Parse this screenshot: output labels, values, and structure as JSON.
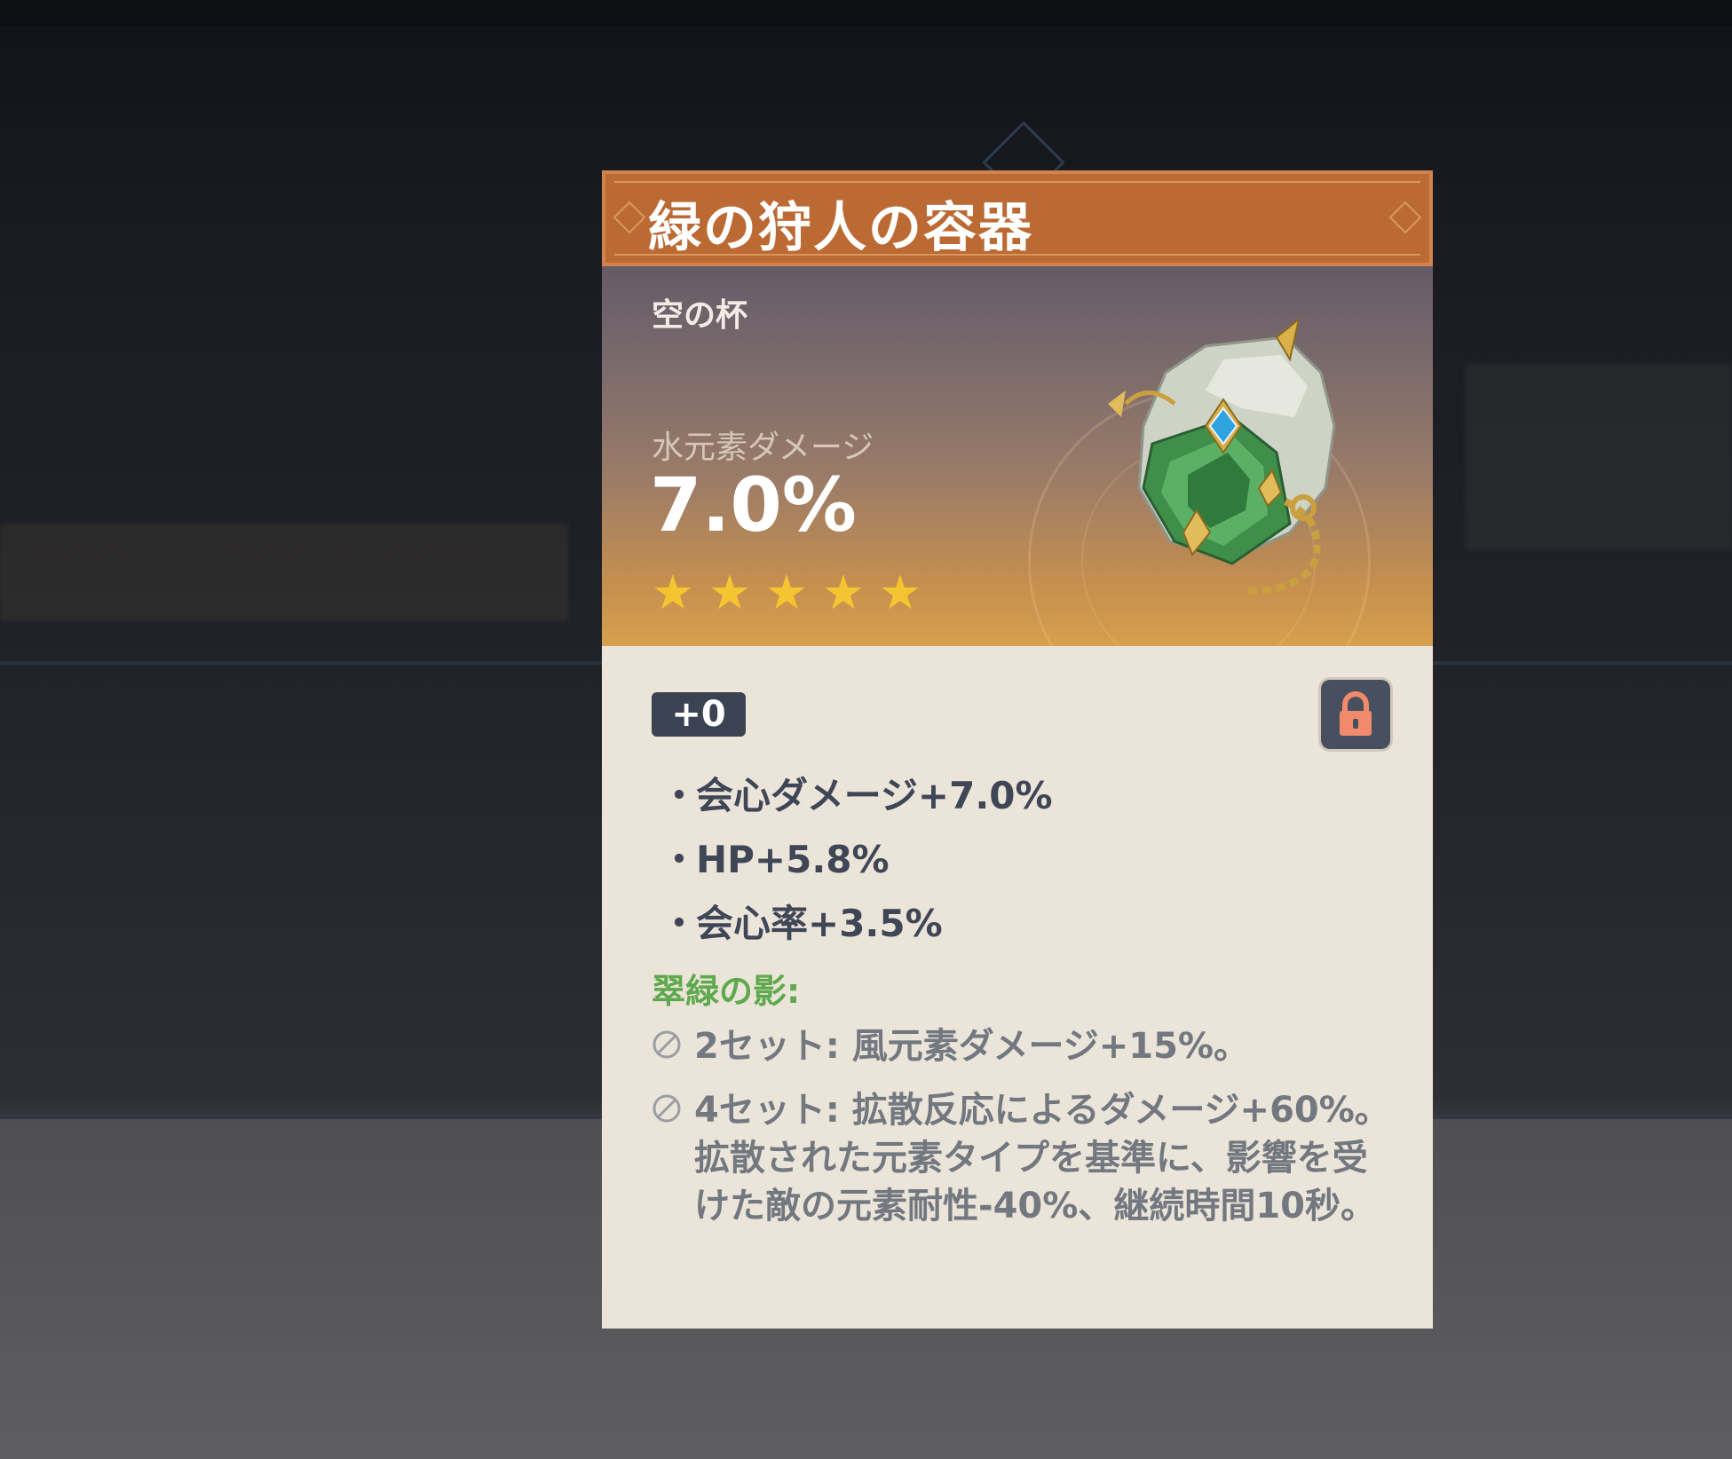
{
  "artifact": {
    "name": "緑の狩人の容器",
    "slot": "空の杯",
    "main_stat_label": "水元素ダメージ",
    "main_stat_value": "7.0%",
    "rarity_stars": 5,
    "level": "+0",
    "locked": true,
    "substats": [
      "会心ダメージ+7.0%",
      "HP+5.8%",
      "会心率+3.5%"
    ],
    "set_name": "翠緑の影:",
    "set_effects": [
      "2セット: 風元素ダメージ+15%。",
      "4セット: 拡散反応によるダメージ+60%。拡散された元素タイプを基準に、影響を受けた敵の元素耐性-40%、継続時間10秒。"
    ]
  },
  "colors": {
    "title_bar": "#bb6a34",
    "set_name_green": "#5ea94d",
    "star_gold": "#f5c531",
    "body_bg": "#ebe4d9"
  },
  "icons": [
    "star-icon",
    "lock-icon",
    "set-effect-inactive-icon",
    "artifact-goblet-image"
  ]
}
